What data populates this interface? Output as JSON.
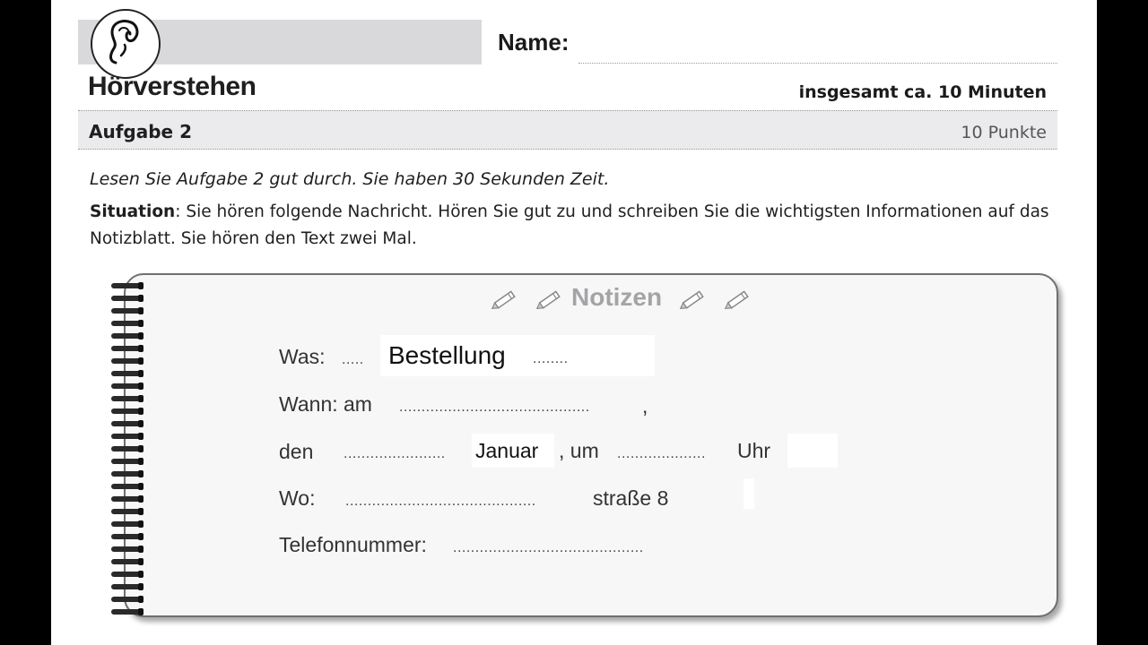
{
  "header": {
    "name_label": "Name:",
    "title": "Hörverstehen",
    "total_time": "insgesamt ca. 10 Minuten"
  },
  "task": {
    "title": "Aufgabe 2",
    "points": "10 Punkte"
  },
  "instruction": "Lesen Sie Aufgabe 2 gut durch. Sie haben 30 Sekunden Zeit.",
  "situation": {
    "label": "Situation",
    "text_line1": ": Sie hören folgende Nachricht. Hören Sie gut zu und schreiben Sie die wichtigsten Informationen auf das",
    "text_line2": "Notizblatt. Sie hören den Text zwei Mal."
  },
  "notepad": {
    "title": "Notizen",
    "was_label": "Was:",
    "was_dots_before": ".....",
    "was_answer": "Bestellung",
    "was_dots_after": "........",
    "wann_label": "Wann: am",
    "wann_dots": "...........................................",
    "wann_comma": ",",
    "den_label": "den",
    "den_dots": ".......................",
    "den_answer": "Januar",
    "um_label": ", um",
    "um_dots": "....................",
    "uhr_label": "Uhr",
    "wo_label": "Wo:",
    "wo_dots": "...........................................",
    "wo_answer": "straße 8",
    "tel_label": "Telefonnummer:",
    "tel_dots": "..........................................."
  },
  "icons": {
    "ear": "ear-icon",
    "pencil": "pencil-icon"
  }
}
